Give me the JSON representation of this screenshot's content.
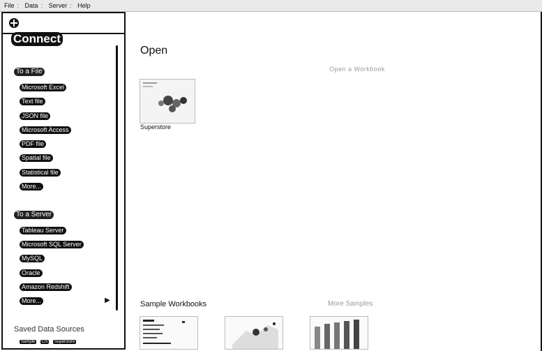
{
  "menu": {
    "items": [
      "File",
      "Data",
      "Server",
      "Help"
    ]
  },
  "sidebar": {
    "connect_title": "Connect",
    "file_section": {
      "heading": "To a File",
      "items": [
        "Microsoft Excel",
        "Text file",
        "JSON file",
        "Microsoft Access",
        "PDF file",
        "Spatial file",
        "Statistical file",
        "More..."
      ]
    },
    "server_section": {
      "heading": "To a Server",
      "items": [
        "Tableau Server",
        "Microsoft SQL Server",
        "MySQL",
        "Oracle",
        "Amazon Redshift",
        "More..."
      ]
    },
    "saved_heading": "Saved Data Sources",
    "saved_items": [
      "Sample",
      "CS",
      "Superstore"
    ]
  },
  "main": {
    "open_title": "Open",
    "open_hint": "Open a Workbook",
    "recent": [
      {
        "label": "Superstore"
      }
    ],
    "samples_title": "Sample Workbooks",
    "samples_hint": "More Samples"
  }
}
